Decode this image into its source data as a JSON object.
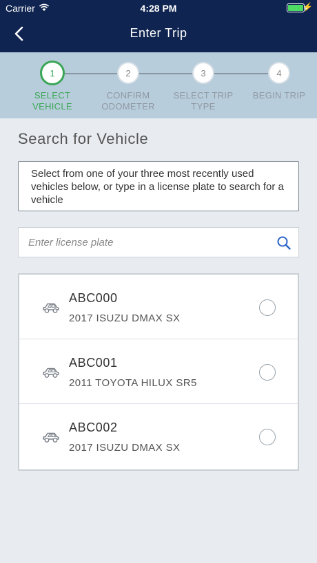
{
  "status_bar": {
    "carrier": "Carrier",
    "time": "4:28 PM",
    "battery_level": 1.0,
    "battery_color": "#4cd964"
  },
  "nav": {
    "title": "Enter Trip",
    "back_icon": "chevron-left-icon"
  },
  "steps": [
    {
      "number": "1",
      "label_line1": "SELECT",
      "label_line2": "VEHICLE",
      "active": true
    },
    {
      "number": "2",
      "label_line1": "CONFIRM",
      "label_line2": "ODOMETER",
      "active": false
    },
    {
      "number": "3",
      "label_line1": "SELECT TRIP",
      "label_line2": "TYPE",
      "active": false
    },
    {
      "number": "4",
      "label_line1": "BEGIN TRIP",
      "label_line2": "",
      "active": false
    }
  ],
  "main": {
    "heading": "Search for Vehicle",
    "info": "Select from one of your three most recently used vehicles below, or type in a license plate to search for a vehicle",
    "search": {
      "value": "",
      "placeholder": "Enter license plate",
      "icon": "search-icon"
    },
    "vehicles": [
      {
        "plate": "ABC000",
        "model": "2017 ISUZU DMAX SX",
        "selected": false
      },
      {
        "plate": "ABC001",
        "model": "2011 TOYOTA HILUX SR5",
        "selected": false
      },
      {
        "plate": "ABC002",
        "model": "2017 ISUZU DMAX SX",
        "selected": false
      }
    ]
  },
  "colors": {
    "header": "#0f2450",
    "stepper_bg": "#b8cddb",
    "active_step": "#3aa655",
    "search_icon": "#2a64c8"
  }
}
